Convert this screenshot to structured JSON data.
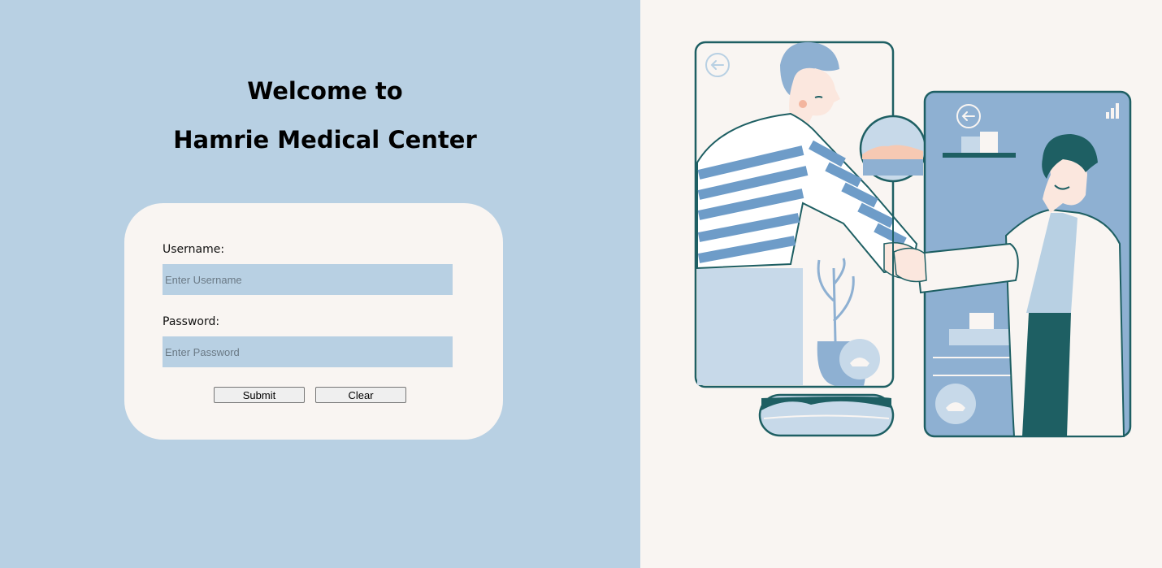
{
  "header": {
    "line1": "Welcome to",
    "line2": "Hamrie Medical Center"
  },
  "login": {
    "username_label": "Username:",
    "username_placeholder": "Enter Username",
    "password_label": "Password:",
    "password_placeholder": "Enter Password",
    "submit_label": "Submit",
    "clear_label": "Clear"
  },
  "colors": {
    "left_bg": "#b8d0e3",
    "right_bg": "#f9f5f2",
    "illustration_teal": "#1e5f63",
    "illustration_blue": "#8eb0d2"
  },
  "illustration": {
    "subject": "patient-doctor-handshake"
  }
}
